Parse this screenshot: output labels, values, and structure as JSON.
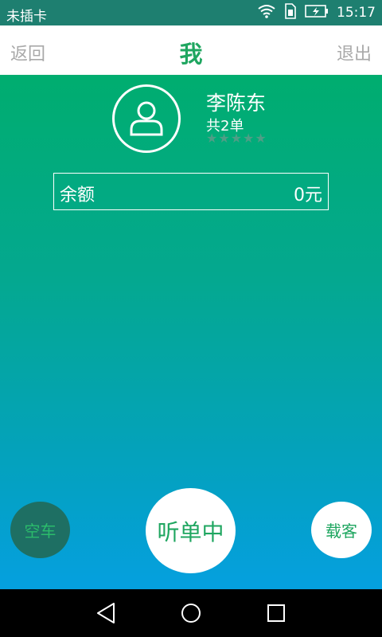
{
  "status_bar": {
    "carrier": "未插卡",
    "time": "15:17",
    "icons": [
      "wifi-icon",
      "sim-icon",
      "battery-charging-icon"
    ]
  },
  "header": {
    "back_label": "返回",
    "title": "我",
    "logout_label": "退出"
  },
  "profile": {
    "avatar_icon": "user-icon",
    "name": "李陈东",
    "orders": "共2单",
    "rating_stars": 5
  },
  "balance": {
    "label": "余额",
    "value": "0元"
  },
  "actions": {
    "empty_label": "空车",
    "listening_label": "听单中",
    "carry_label": "载客"
  },
  "nav_bar": {
    "icons": [
      "back-icon",
      "home-icon",
      "recents-icon"
    ]
  },
  "colors": {
    "accent": "#1fa660",
    "gradient_top": "#00ad6f",
    "gradient_bottom": "#05a0df"
  }
}
